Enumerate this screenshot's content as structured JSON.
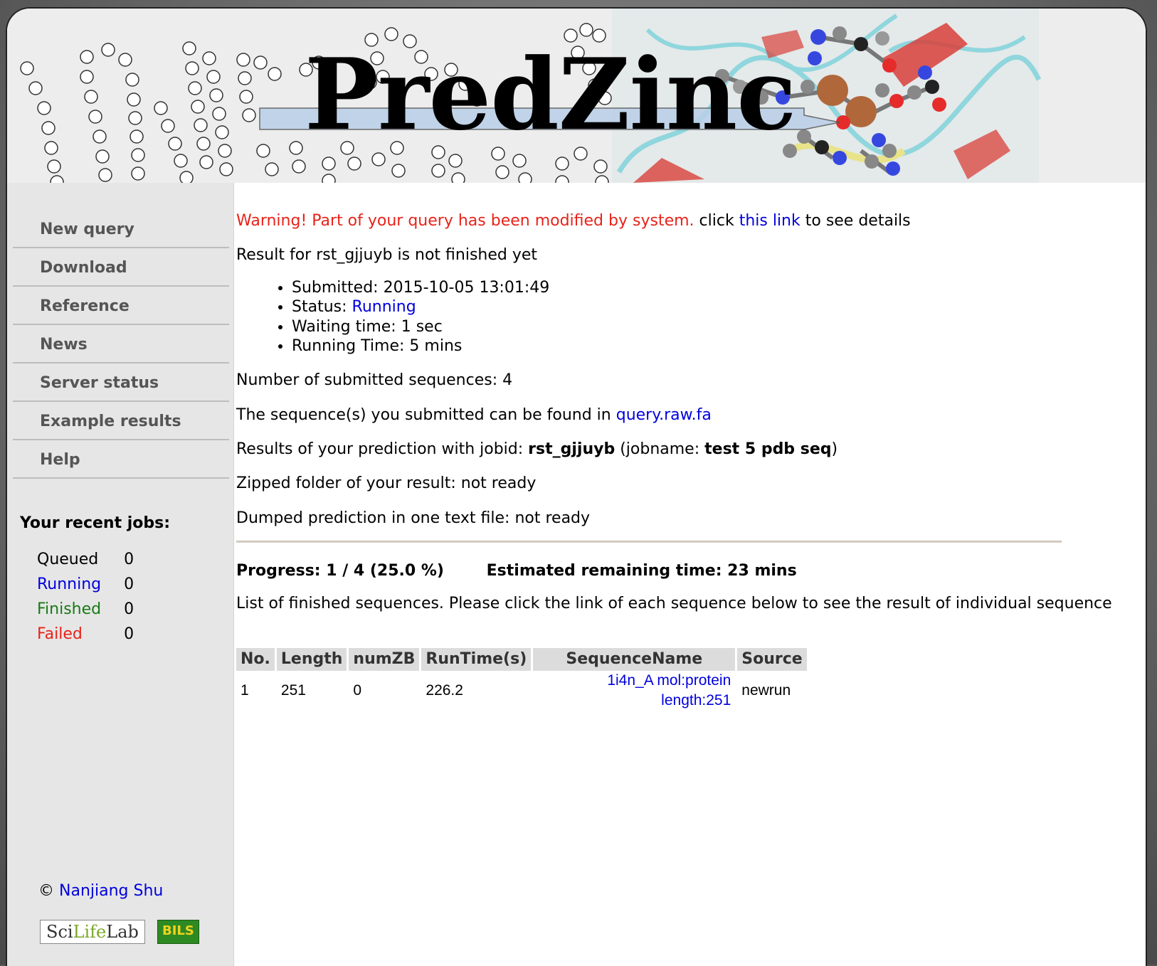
{
  "banner": {
    "site_title": "PredZinc"
  },
  "nav": {
    "items": [
      {
        "label": "New query"
      },
      {
        "label": "Download"
      },
      {
        "label": "Reference"
      },
      {
        "label": "News"
      },
      {
        "label": "Server status"
      },
      {
        "label": "Example results"
      },
      {
        "label": "Help"
      }
    ]
  },
  "recent_jobs": {
    "title": "Your recent jobs:",
    "rows": [
      {
        "label": "Queued",
        "count": "0",
        "color": "#000000"
      },
      {
        "label": "Running",
        "count": "0",
        "color": "#0000dd"
      },
      {
        "label": "Finished",
        "count": "0",
        "color": "#187a14"
      },
      {
        "label": "Failed",
        "count": "0",
        "color": "#e8231a"
      }
    ]
  },
  "footer": {
    "copyright_symbol": "©",
    "author": "Nanjiang Shu",
    "logo_scilife_part1": "Sci",
    "logo_scilife_part2": "Life",
    "logo_scilife_part3": "Lab",
    "logo_bils": "BILS"
  },
  "content": {
    "warning_text": "Warning! Part of your query has been modified by system.",
    "warning_click": "click",
    "warning_link": "this link",
    "warning_tail": "to see details",
    "result_status": "Result for rst_gjjuyb is not finished yet",
    "info": {
      "submitted_label": "Submitted:",
      "submitted_value": "2015-10-05 13:01:49",
      "status_label": "Status:",
      "status_value": "Running",
      "waiting_label": "Waiting time:",
      "waiting_value": "1 sec",
      "running_label": "Running Time:",
      "running_value": "5 mins"
    },
    "num_sequences": "Number of submitted sequences: 4",
    "seq_found_text": "The sequence(s) you submitted can be found in",
    "seq_found_link": "query.raw.fa",
    "results_prefix": "Results of your prediction with jobid:",
    "jobid": "rst_gjjuyb",
    "jobname_prefix": "(jobname:",
    "jobname": "test 5 pdb seq",
    "jobname_suffix": ")",
    "zipped": "Zipped folder of your result: not ready",
    "dumped": "Dumped prediction in one text file: not ready",
    "progress": "Progress: 1 / 4 (25.0 %)",
    "remaining": "Estimated remaining time: 23 mins",
    "list_desc": "List of finished sequences. Please click the link of each sequence below to see the result of individual sequence"
  },
  "results_table": {
    "headers": [
      "No.",
      "Length",
      "numZB",
      "RunTime(s)",
      "SequenceName",
      "Source"
    ],
    "rows": [
      {
        "no": "1",
        "length": "251",
        "numzb": "0",
        "runtime": "226.2",
        "name": "1i4n_A mol:protein length:251",
        "source": "newrun"
      }
    ]
  }
}
